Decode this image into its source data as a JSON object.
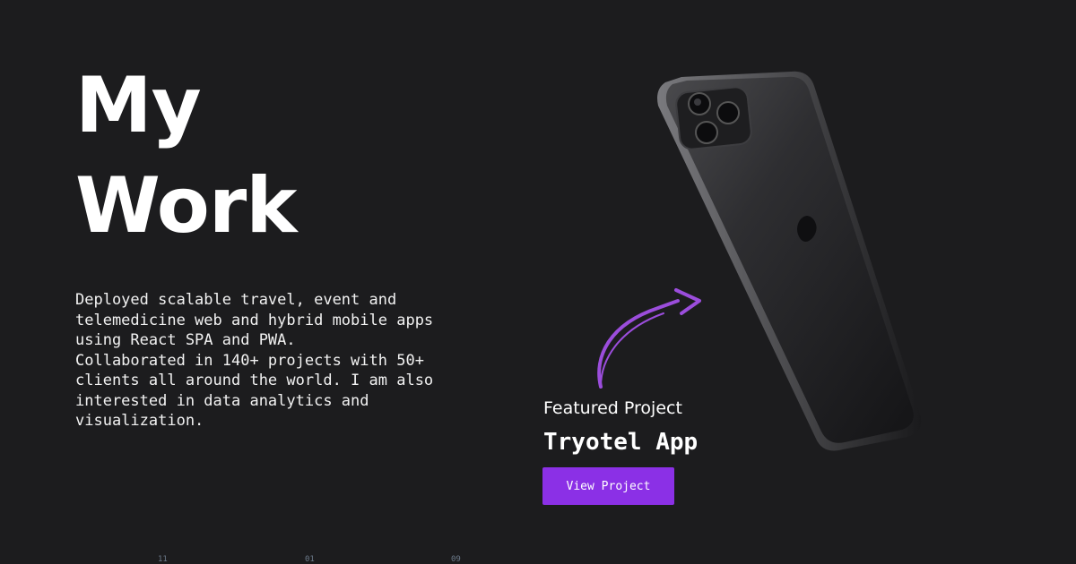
{
  "hero": {
    "title_line1": "My",
    "title_line2": "Work"
  },
  "description": "Deployed scalable travel, event and\ntelemedicine web and hybrid mobile apps\nusing React SPA and PWA.\nCollaborated in 140+ projects with 50+\nclients all around the world. I am also\ninterested in data analytics and\nvisualization.",
  "featured": {
    "label": "Featured Project",
    "project_name": "Tryotel App",
    "button_label": "View Project"
  },
  "footer": {
    "numbers": [
      "11",
      "01",
      "09"
    ]
  },
  "colors": {
    "background": "#1c1c1e",
    "accent": "#8b30e6",
    "arrow": "#9b4ddc"
  },
  "icons": {
    "arrow": "curved-arrow-icon",
    "phone": "phone-image"
  }
}
